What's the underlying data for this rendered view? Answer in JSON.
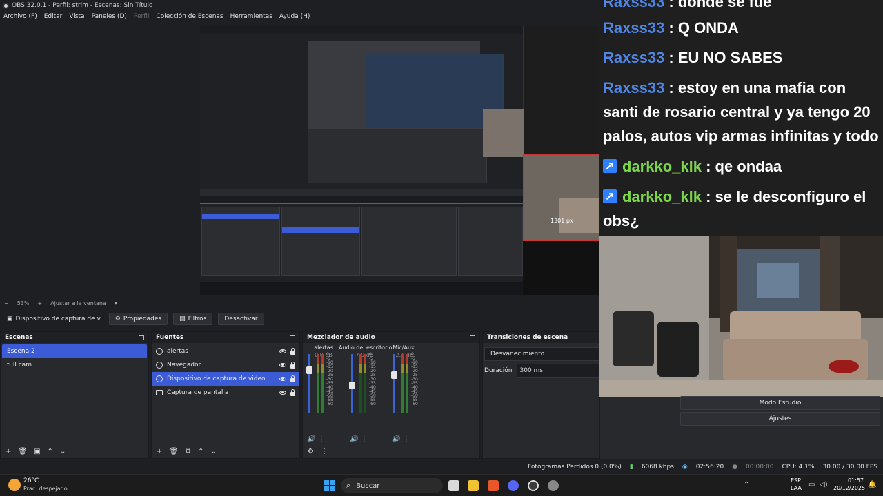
{
  "window": {
    "title": "OBS 32.0.1 - Perfil: strim - Escenas: Sin Título"
  },
  "menu": [
    "Archivo (F)",
    "Editar",
    "Vista",
    "Paneles (D)",
    "Perfil",
    "Colección de Escenas",
    "Herramientas",
    "Ayuda (H)"
  ],
  "preview": {
    "overlay_label": "1301 px",
    "zoom": "53%",
    "fit_label": "Ajustar a la ventana"
  },
  "source_toolbar": {
    "source_name": "Dispositivo de captura de v",
    "properties": "Propiedades",
    "filters": "Filtros",
    "deactivate": "Desactivar"
  },
  "scenes": {
    "title": "Escenas",
    "items": [
      "Escena 2",
      "full cam"
    ],
    "selected": 0
  },
  "sources": {
    "title": "Fuentes",
    "items": [
      {
        "name": "alertas",
        "icon": "globe-icon"
      },
      {
        "name": "Navegador",
        "icon": "globe-icon"
      },
      {
        "name": "Dispositivo de captura de video",
        "icon": "camera-icon"
      },
      {
        "name": "Captura de pantalla",
        "icon": "monitor-icon"
      }
    ],
    "selected": 2
  },
  "mixer": {
    "title": "Mezclador de audio",
    "channels": [
      {
        "name": "alertas",
        "db": "0.0 dB",
        "level": 1.0
      },
      {
        "name": "Audio del escritorio",
        "db": "-7.0 dB",
        "level": 0.75
      },
      {
        "name": "Mic/Aux",
        "db": "-2.1 dB",
        "level": 0.92
      }
    ],
    "ticks": [
      "0",
      "-5",
      "-10",
      "-15",
      "-20",
      "-25",
      "-30",
      "-35",
      "-40",
      "-45",
      "-50",
      "-55",
      "-60"
    ]
  },
  "transitions": {
    "title": "Transiciones de escena",
    "type": "Desvanecimiento",
    "duration_label": "Duración",
    "duration": "300 ms"
  },
  "controls": {
    "studio_mode": "Modo Estudio",
    "settings": "Ajustes"
  },
  "chat": {
    "lines": [
      {
        "user": "Raxss33",
        "text": " : donde se fue",
        "platform": "none"
      },
      {
        "user": "Raxss33",
        "text": " : Q ONDA",
        "platform": "none"
      },
      {
        "user": "Raxss33",
        "text": " : EU NO SABES",
        "platform": "none"
      },
      {
        "user": "Raxss33",
        "text": " : estoy en una mafia con",
        "platform": "none"
      },
      {
        "user": "",
        "text": "santi de rosario central y ya tengo 20",
        "platform": "none"
      },
      {
        "user": "",
        "text": "palos, autos vip armas infinitas y todo",
        "platform": "none"
      },
      {
        "user": "darkko_klk",
        "text": " : qe ondaa",
        "platform": "kick"
      },
      {
        "user": "darkko_klk",
        "text": " : se le desconfiguro el",
        "platform": "kick"
      },
      {
        "user": "",
        "text": "obs¿",
        "platform": "none"
      }
    ]
  },
  "statusbar": {
    "dropped": "Fotogramas Perdidos 0 (0.0%)",
    "bitrate": "6068 kbps",
    "stream_time": "02:56:20",
    "rec_time": "00:00:00",
    "cpu": "CPU: 4.1%",
    "fps": "30.00 / 30.00 FPS"
  },
  "taskbar": {
    "weather_temp": "26°C",
    "weather_desc": "Prac. despejado",
    "search": "Buscar",
    "lang": "ESP",
    "lang2": "LAA",
    "time": "01:57",
    "date": "20/12/2025"
  },
  "colors": {
    "accent": "#3c5bd6",
    "raxss": "#4f86e5",
    "darkko": "#7cd64c",
    "kick": "#2f80ff"
  }
}
